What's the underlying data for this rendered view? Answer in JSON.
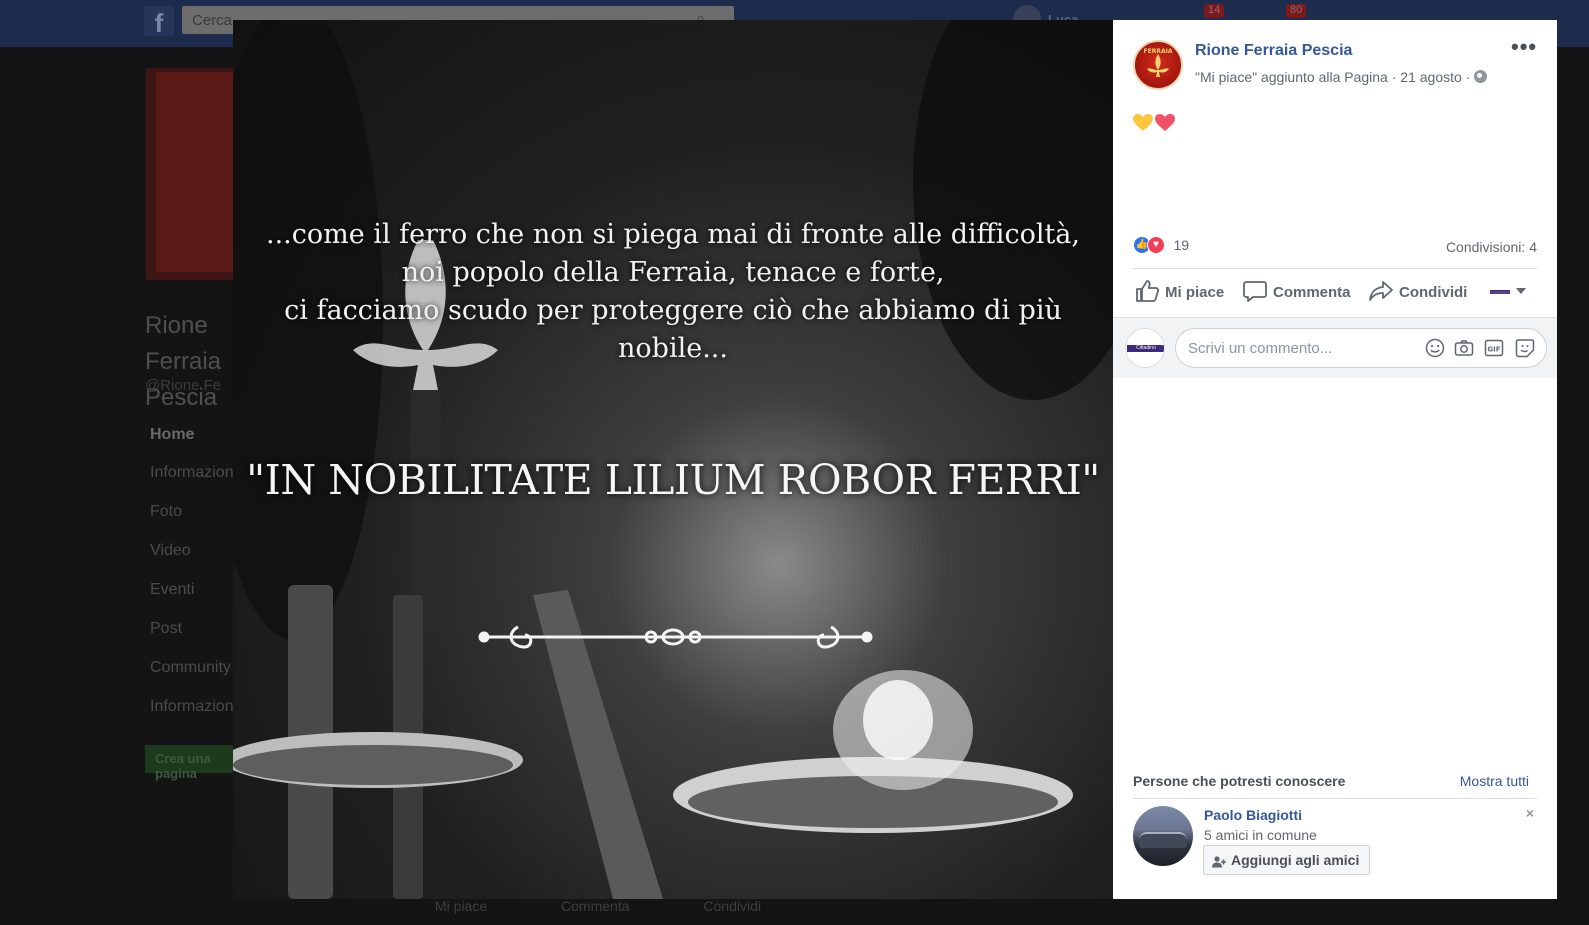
{
  "background_page": {
    "search_placeholder": "Cerca",
    "notification_badges": [
      "14",
      "80"
    ],
    "user_name": "Luca",
    "page_name": "Rione Ferraia Pescia",
    "page_handle": "@Rione.Fe",
    "nav_items": [
      "Home",
      "Informazioni",
      "Foto",
      "Video",
      "Eventi",
      "Post",
      "Community",
      "Informazioni"
    ],
    "create_button": "Crea una pagina",
    "action_bar": [
      "Mi piace",
      "Commenta",
      "Condividi"
    ]
  },
  "photo": {
    "quote_lines": [
      "...come il ferro che non si piega mai di fronte alle difficoltà,",
      "noi popolo della Ferraia, tenace e forte,",
      "ci facciamo scudo per proteggere ciò che abbiamo di più nobile..."
    ],
    "motto": "\"IN NOBILITATE LILIUM ROBOR FERRI\""
  },
  "post": {
    "page_name": "Rione Ferraia Pescia",
    "avatar_label": "FERRAIA",
    "meta_text": "\"Mi piace\" aggiunto alla Pagina · 21 agosto ·",
    "more_label": "•••",
    "emojis": [
      "yellow-heart",
      "red-heart"
    ],
    "reaction_count": "19",
    "shares": "Condivisioni: 4",
    "actions": {
      "like": "Mi piace",
      "comment": "Comm​enta",
      "share": "Condividi"
    },
    "comment_placeholder": "Scrivi un commento...",
    "commenter_avatar_label": "Cittadino"
  },
  "suggestions": {
    "title": "Persone che potresti conoscere",
    "see_all": "Mostra tutti",
    "person": {
      "name": "Paolo Biagiotti",
      "mutual": "5 amici in comune",
      "add_button": "Aggiungi agli amici",
      "dismiss": "×"
    }
  },
  "colors": {
    "link_blue": "#365899",
    "like_blue": "#2c74f3",
    "love_red": "#f33e58",
    "yellow_heart": "#fbc63c",
    "red_heart": "#f25268"
  }
}
